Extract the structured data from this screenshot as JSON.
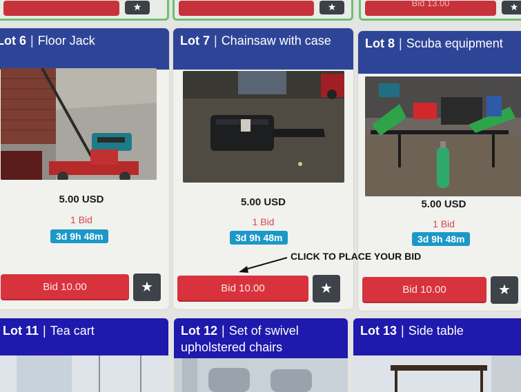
{
  "previous_row": {
    "bid_label_partial": "Bid 13.00",
    "star_icon": "★"
  },
  "lots": [
    {
      "number": "Lot 6",
      "separator": "|",
      "title": "Floor Jack",
      "price": "5.00 USD",
      "bids": "1 Bid",
      "time_left": "3d 9h 48m",
      "bid_button": "Bid 10.00",
      "star_icon": "★"
    },
    {
      "number": "Lot 7",
      "separator": "|",
      "title": "Chainsaw with case",
      "price": "5.00 USD",
      "bids": "1 Bid",
      "time_left": "3d 9h 48m",
      "bid_button": "Bid 10.00",
      "star_icon": "★"
    },
    {
      "number": "Lot 8",
      "separator": "|",
      "title": "Scuba equipment",
      "price": "5.00 USD",
      "bids": "1 Bid",
      "time_left": "3d 9h 48m",
      "bid_button": "Bid 10.00",
      "star_icon": "★"
    }
  ],
  "next_row": [
    {
      "number": "Lot 11",
      "separator": "|",
      "title": "Tea cart"
    },
    {
      "number": "Lot 12",
      "separator": "|",
      "title_line1": "Set of swivel",
      "title_line2": "upholstered chairs"
    },
    {
      "number": "Lot 13",
      "separator": "|",
      "title": "Side table"
    }
  ],
  "annotation": "CLICK TO PLACE YOUR BID",
  "colors": {
    "header_blue": "#2e4597",
    "header_deep_blue": "#1f19ad",
    "bid_red": "#d8323c",
    "time_badge": "#1c98c8",
    "bid_count_red": "#d6474e",
    "star_button": "#3e434a"
  }
}
